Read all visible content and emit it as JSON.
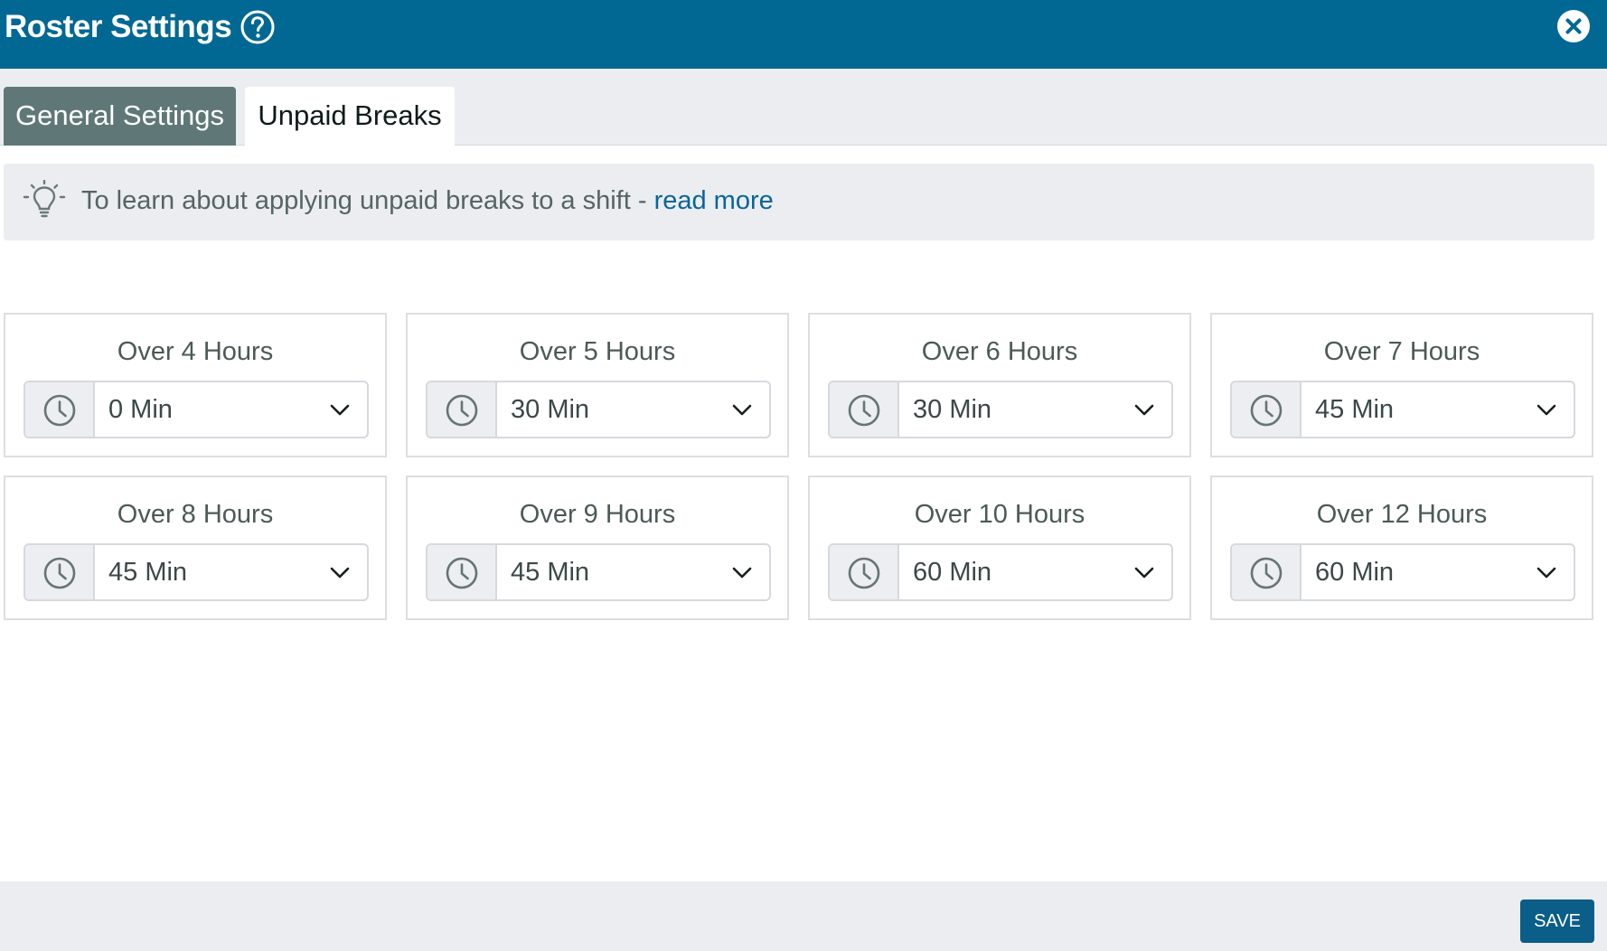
{
  "header": {
    "title": "Roster Settings",
    "help_icon": "question-circle-icon",
    "close_icon": "close-circle-icon"
  },
  "tabs": [
    {
      "label": "General Settings",
      "active": false
    },
    {
      "label": "Unpaid Breaks",
      "active": true
    }
  ],
  "info": {
    "icon": "lightbulb-icon",
    "text": "To learn about applying unpaid breaks to a shift - ",
    "link": "read more"
  },
  "breaks": [
    {
      "label": "Over 4 Hours",
      "value": "0 Min"
    },
    {
      "label": "Over 5 Hours",
      "value": "30 Min"
    },
    {
      "label": "Over 6 Hours",
      "value": "30 Min"
    },
    {
      "label": "Over 7 Hours",
      "value": "45 Min"
    },
    {
      "label": "Over 8 Hours",
      "value": "45 Min"
    },
    {
      "label": "Over 9 Hours",
      "value": "45 Min"
    },
    {
      "label": "Over 10 Hours",
      "value": "60 Min"
    },
    {
      "label": "Over 12 Hours",
      "value": "60 Min"
    }
  ],
  "footer": {
    "save_label": "SAVE"
  },
  "colors": {
    "header_bg": "#006893",
    "active_tab_bg": "#5f7777",
    "link": "#0a6597",
    "save_bg": "#0a5e87",
    "panel_bg": "#ebedf1"
  }
}
